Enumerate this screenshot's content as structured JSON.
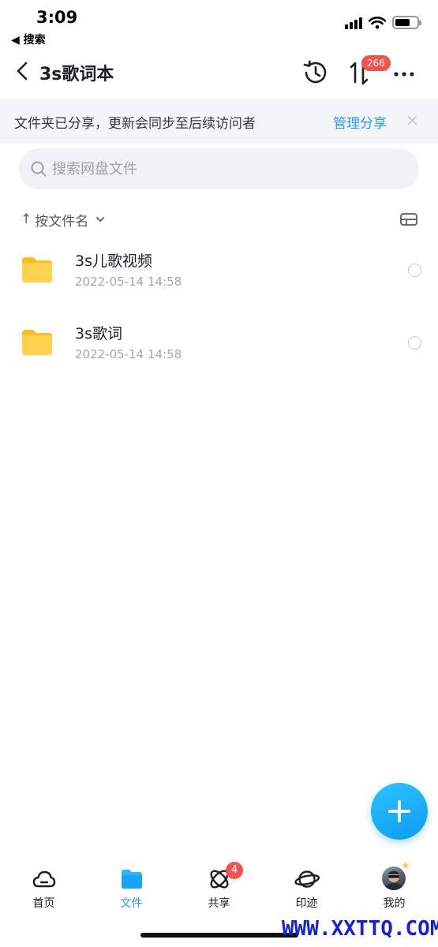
{
  "status_bar": {
    "time": "3:09",
    "back_app": "◀ 搜索"
  },
  "nav": {
    "title": "3s歌词本",
    "transfer_badge": "266"
  },
  "share_notice": {
    "text": "文件夹已分享，更新会同步至后续访问者",
    "action": "管理分享",
    "close": "×"
  },
  "search": {
    "placeholder": "搜索网盘文件"
  },
  "sort": {
    "arrow": "↑",
    "label": "按文件名"
  },
  "files": [
    {
      "name": "3s儿歌视频",
      "date": "2022-05-14 14:58",
      "icon": "folder-icon"
    },
    {
      "name": "3s歌词",
      "date": "2022-05-14 14:58",
      "icon": "folder-icon"
    }
  ],
  "tabs": [
    {
      "label": "首页",
      "icon": "cloud-icon"
    },
    {
      "label": "文件",
      "icon": "folder-icon",
      "active": true
    },
    {
      "label": "共享",
      "icon": "orbit-icon",
      "badge": "4"
    },
    {
      "label": "印迹",
      "icon": "planet-icon"
    },
    {
      "label": "我的",
      "icon": "avatar"
    }
  ],
  "watermark": "WWW.XXTTQ.COM",
  "colors": {
    "accent": "#1a9cf5",
    "badge": "#f5514f",
    "folder": "#ffc62c",
    "notice_bg": "#f4f5f7"
  }
}
